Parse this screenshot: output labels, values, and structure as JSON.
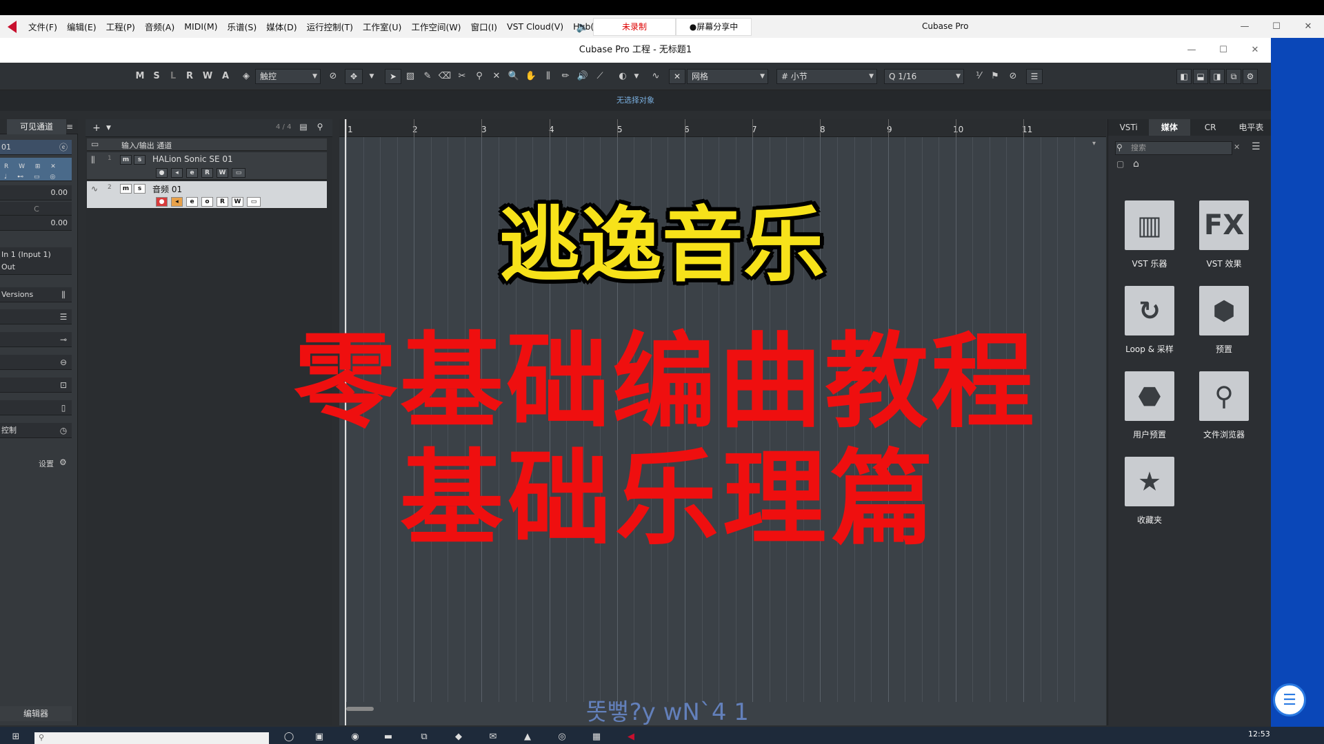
{
  "menubar": {
    "items": [
      "文件(F)",
      "编辑(E)",
      "工程(P)",
      "音频(A)",
      "MIDI(M)",
      "乐谱(S)",
      "媒体(D)",
      "运行控制(T)",
      "工作室(U)",
      "工作空间(W)",
      "窗口(I)",
      "VST Cloud(V)",
      "Hub(I"
    ],
    "record_status": "未录制",
    "screen_share": "●屏幕分享中",
    "app_name": "Cubase Pro"
  },
  "window": {
    "title": "Cubase Pro 工程 - 无标题1"
  },
  "toolbar": {
    "mode_buttons": [
      "M",
      "S",
      "L",
      "R",
      "W",
      "A"
    ],
    "automation_mode": "触控",
    "snap_type": "网格",
    "grid_type": "小节",
    "quantize": "1/16"
  },
  "info_line": "无选择对象",
  "inspector": {
    "tab": "可见通道",
    "track_name": "01",
    "value1": "0.00",
    "value2": "0.00",
    "rows": [
      "In 1 (Input 1)",
      "Out",
      "Versions",
      "",
      "",
      "",
      "",
      "",
      "控制"
    ],
    "settings_label": "设置",
    "editor_label": "编辑器"
  },
  "tracklist": {
    "count": "4 / 4",
    "tracks": [
      {
        "number": "",
        "name": "输入/输出 通道"
      },
      {
        "number": "1",
        "name": "HALion Sonic SE 01"
      },
      {
        "number": "2",
        "name": "音频 01"
      }
    ]
  },
  "ruler": {
    "bars": [
      "1",
      "2",
      "3",
      "4",
      "5",
      "6",
      "7",
      "8",
      "9",
      "10",
      "11"
    ]
  },
  "rightzone": {
    "tabs": [
      "VSTi",
      "媒体",
      "CR",
      "电平表"
    ],
    "active_tab": "媒体",
    "search_placeholder": "搜索",
    "tiles": [
      {
        "label": "VST 乐器",
        "icon": "piano-icon"
      },
      {
        "label": "VST 效果",
        "icon": "fx-icon"
      },
      {
        "label": "Loop & 采样",
        "icon": "loop-icon"
      },
      {
        "label": "预置",
        "icon": "presets-icon"
      },
      {
        "label": "用户预置",
        "icon": "user-presets-icon"
      },
      {
        "label": "文件浏览器",
        "icon": "file-browser-icon"
      },
      {
        "label": "收藏夹",
        "icon": "star-icon"
      }
    ]
  },
  "overlay": {
    "title": "逃逸音乐",
    "line1": "零基础编曲教程",
    "line2": "基础乐理篇",
    "garbled": "똣뻫?y wN`4 1"
  },
  "taskbar": {
    "clock": "12:53"
  },
  "colors": {
    "title_yellow": "#f7e21a",
    "title_red": "#ef0f0f",
    "record_red": "#c8102e"
  }
}
